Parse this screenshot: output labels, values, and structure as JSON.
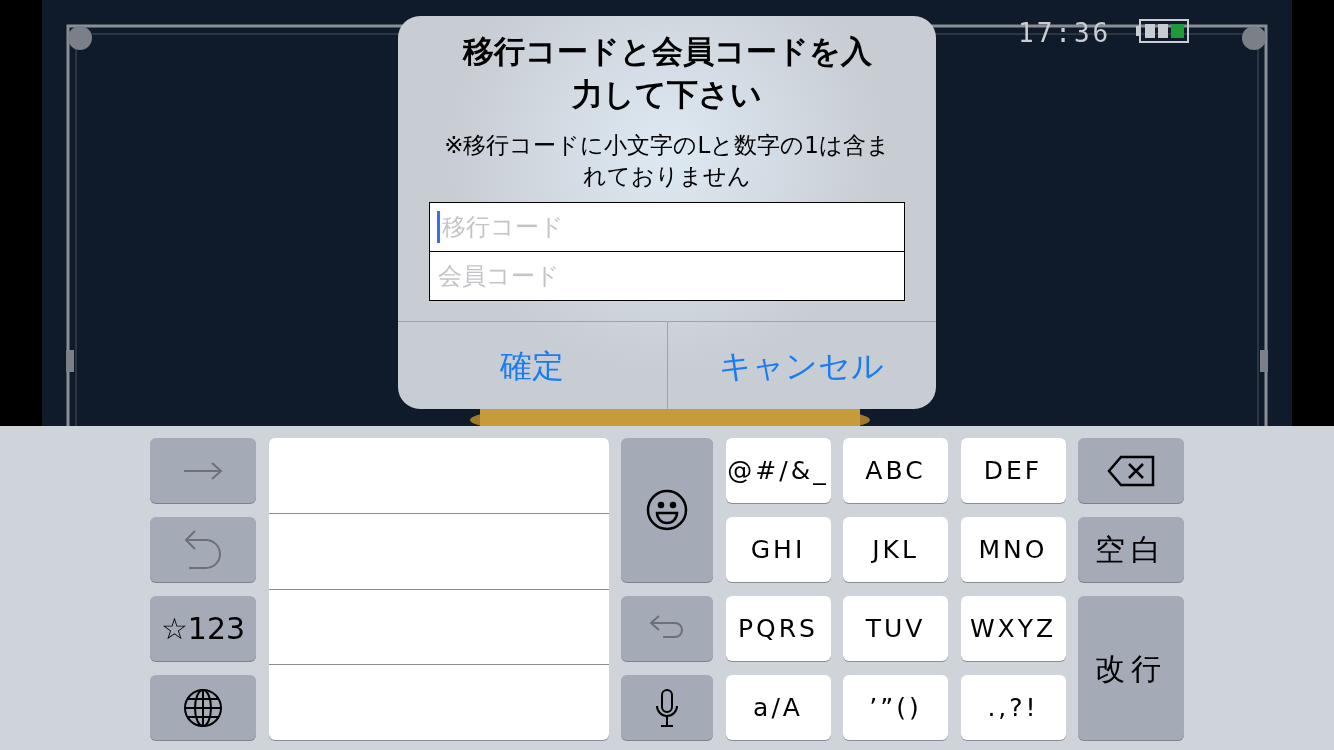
{
  "game": {
    "time": "17:36"
  },
  "dialog": {
    "title": "移行コードと会員コードを入力して下さい",
    "message": "※移行コードに小文字のLと数字の1は含まれておりません",
    "fields": [
      {
        "placeholder": "移行コード",
        "focused": true
      },
      {
        "placeholder": "会員コード",
        "focused": false
      }
    ],
    "buttons": [
      "確定",
      "キャンセル"
    ]
  },
  "keyboard": {
    "letter_keys": [
      "@#/&_",
      "ABC",
      "DEF",
      "GHI",
      "JKL",
      "MNO",
      "PQRS",
      "TUV",
      "WXYZ",
      "a/A",
      "’”()",
      ".,?!"
    ],
    "symbols_key": "☆123",
    "space_key": "空白",
    "return_key": "改行"
  }
}
